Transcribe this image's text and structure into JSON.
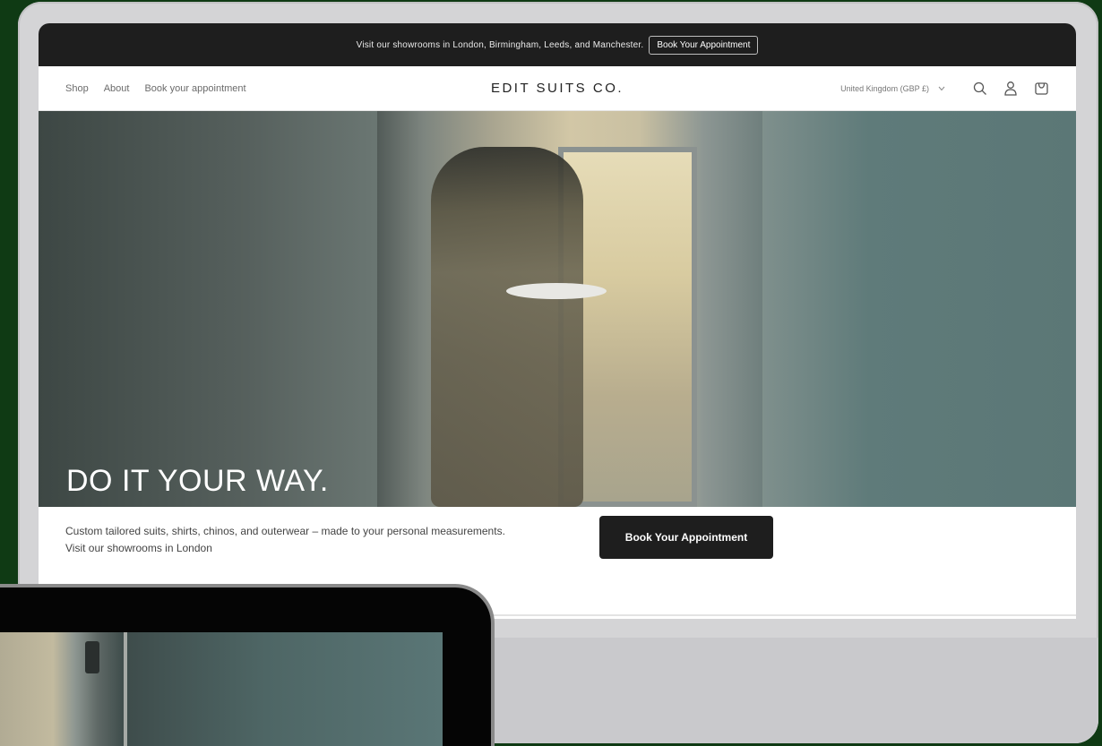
{
  "announcement": {
    "text": "Visit our showrooms in London, Birmingham, Leeds, and Manchester.",
    "button_label": "Book Your Appointment"
  },
  "header": {
    "nav": [
      "Shop",
      "About",
      "Book your appointment"
    ],
    "logo": "EDIT SUITS CO.",
    "country_selector": "United Kingdom (GBP £)",
    "icons": [
      "search-icon",
      "account-icon",
      "cart-icon"
    ]
  },
  "hero": {
    "title": "DO IT YOUR WAY."
  },
  "intro": {
    "text": "Custom tailored suits, shirts, chinos, and outerwear – made to your personal measurements. Visit our showrooms in London",
    "cta_label": "Book Your Appointment"
  },
  "colors": {
    "background": "#0f3a14",
    "announcement_bar": "#1e1e1e",
    "cta": "#1e1e1e"
  }
}
